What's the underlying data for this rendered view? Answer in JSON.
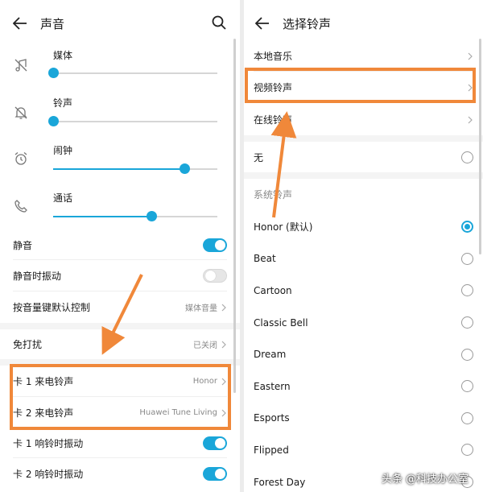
{
  "left_panel": {
    "title": "声音",
    "volumes": [
      {
        "label": "媒体",
        "icon": "media-muted-icon",
        "level": 0.0
      },
      {
        "label": "铃声",
        "icon": "bell-muted-icon",
        "level": 0.0
      },
      {
        "label": "闹钟",
        "icon": "alarm-clock-icon",
        "level": 0.8
      },
      {
        "label": "通话",
        "icon": "phone-icon",
        "level": 0.6
      }
    ],
    "silent_label": "静音",
    "vibrate_when_silent_label": "静音时振动",
    "volume_key_label": "按音量键默认控制",
    "volume_key_value": "媒体音量",
    "dnd_label": "免打扰",
    "dnd_value": "已关闭",
    "sim1_ringtone_label": "卡 1 来电铃声",
    "sim1_ringtone_value": "Honor",
    "sim2_ringtone_label": "卡 2 来电铃声",
    "sim2_ringtone_value": "Huawei Tune Living",
    "sim1_vibrate_label": "卡 1 响铃时振动",
    "sim2_vibrate_label": "卡 2 响铃时振动"
  },
  "right_panel": {
    "title": "选择铃声",
    "local_music_label": "本地音乐",
    "video_ringtone_label": "视频铃声",
    "online_ringtone_label": "在线铃声",
    "none_label": "无",
    "system_section_label": "系统铃声",
    "ringtones": [
      "Honor (默认)",
      "Beat",
      "Cartoon",
      "Classic Bell",
      "Dream",
      "Eastern",
      "Esports",
      "Flipped",
      "Forest Day"
    ],
    "selected_index": 0
  },
  "watermark": "头条 @科技办公室",
  "colors": {
    "accent": "#1aa6d9",
    "highlight": "#f0883a"
  }
}
